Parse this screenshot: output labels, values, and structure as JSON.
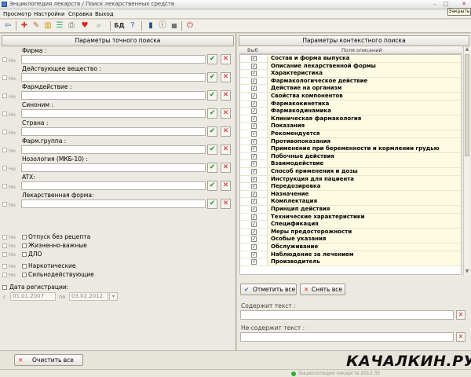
{
  "window": {
    "title": "Энциклопедия лекарств / Поиск лекарственных средств",
    "close_tooltip": "Закрыть"
  },
  "menu": [
    "Просмотр",
    "Настройки",
    "Справка",
    "Выход"
  ],
  "toolbar": {
    "db_label": "БД"
  },
  "left": {
    "header": "Параметры точного поиска",
    "ne": "Не",
    "fields": [
      {
        "label": "Фирма :"
      },
      {
        "label": "Действующее вещество :"
      },
      {
        "label": "Фармдействие :"
      },
      {
        "label": "Синоним :"
      },
      {
        "label": "Страна :"
      },
      {
        "label": "Фарм.группа :"
      },
      {
        "label": "Нозология (МКБ-10) :"
      },
      {
        "label": "ATX:"
      },
      {
        "label": "Лекарственная форма:"
      }
    ],
    "flags": [
      {
        "label": "Отпуск без рецепта"
      },
      {
        "label": "Жизненно-важные"
      },
      {
        "label": "ДЛО"
      },
      {
        "label": "Наркотические"
      },
      {
        "label": "Сильнодействующие"
      }
    ],
    "registration": {
      "label": "Дата регистрации:",
      "from_label": "с",
      "from": "01.01.2007",
      "to_label": "по",
      "to": "03.02.2012"
    },
    "clear_label": "Очистить все"
  },
  "right": {
    "header": "Параметры контекстного поиска",
    "col_sel": "Выб",
    "col_name": "Поля описаний",
    "rows": [
      {
        "label": "Состав и форма выпуска",
        "checked": true
      },
      {
        "label": "Описание лекарственной формы",
        "checked": true
      },
      {
        "label": "Характеристика",
        "checked": true
      },
      {
        "label": "Фармакологическое действие",
        "checked": true
      },
      {
        "label": "Действие на организм",
        "checked": true
      },
      {
        "label": "Свойства компонентов",
        "checked": true
      },
      {
        "label": "Фармакокинетика",
        "checked": true
      },
      {
        "label": "Фармакодинамика",
        "checked": true
      },
      {
        "label": "Клиническая фармакология",
        "checked": true
      },
      {
        "label": "Показания",
        "checked": true
      },
      {
        "label": "Рекомендуется",
        "checked": true
      },
      {
        "label": "Противопоказания",
        "checked": true
      },
      {
        "label": "Применение при беременности и кормлении грудью",
        "checked": true
      },
      {
        "label": "Побочные действия",
        "checked": true
      },
      {
        "label": "Взаимодействие",
        "checked": true
      },
      {
        "label": "Способ применения и дозы",
        "checked": true
      },
      {
        "label": "Инструкция для пациента",
        "checked": true
      },
      {
        "label": "Передозировка",
        "checked": true
      },
      {
        "label": "Назначение",
        "checked": true
      },
      {
        "label": "Комплектация",
        "checked": true
      },
      {
        "label": "Принцип действия",
        "checked": true
      },
      {
        "label": "Технические характеристики",
        "checked": true
      },
      {
        "label": "Спецификация",
        "checked": true
      },
      {
        "label": "Меры предосторожности",
        "checked": true
      },
      {
        "label": "Особые указания",
        "checked": true
      },
      {
        "label": "Обслуживание",
        "checked": true
      },
      {
        "label": "Наблюдение за лечением",
        "checked": true
      },
      {
        "label": "Производитель",
        "checked": true
      }
    ],
    "check_all_label": "Отметить все",
    "uncheck_all_label": "Снять все",
    "contains_label": "Содержит текст :",
    "not_contains_label": "Не содержит текст :"
  },
  "status": {
    "text": "Энциклопедия лекарств 2012.35"
  },
  "watermark": "КАЧАЛКИН.РУ"
}
